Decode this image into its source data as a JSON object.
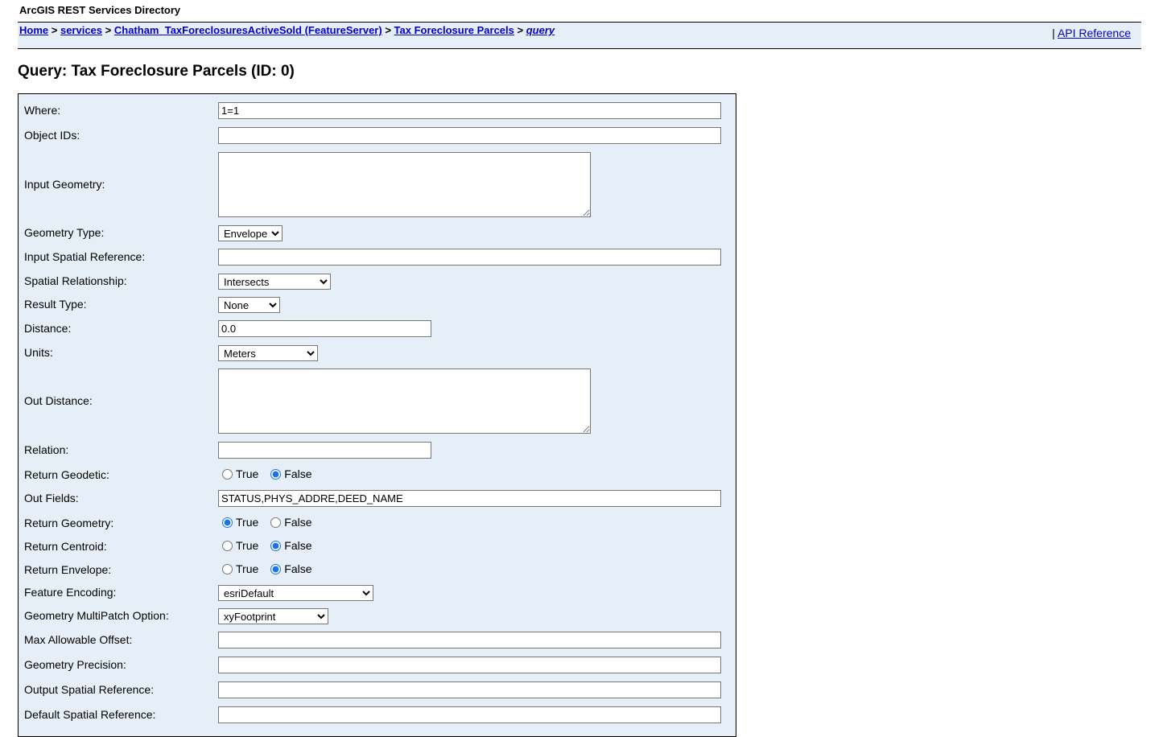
{
  "header": {
    "title": "ArcGIS REST Services Directory"
  },
  "breadcrumb": {
    "home": "Home",
    "services": "services",
    "service": "Chatham_TaxForeclosuresActiveSold (FeatureServer)",
    "layer": "Tax Foreclosure Parcels",
    "current": "query",
    "separator": ">"
  },
  "api_reference": {
    "prefix": "|",
    "label": "API Reference"
  },
  "page_title": "Query: Tax Foreclosure Parcels (ID: 0)",
  "form": {
    "where": {
      "label": "Where:",
      "value": "1=1"
    },
    "object_ids": {
      "label": "Object IDs:",
      "value": ""
    },
    "input_geometry": {
      "label": "Input Geometry:",
      "value": ""
    },
    "geometry_type": {
      "label": "Geometry Type:",
      "value": "Envelope"
    },
    "input_sr": {
      "label": "Input Spatial Reference:",
      "value": ""
    },
    "spatial_rel": {
      "label": "Spatial Relationship:",
      "value": "Intersects"
    },
    "result_type": {
      "label": "Result Type:",
      "value": "None"
    },
    "distance": {
      "label": "Distance:",
      "value": "0.0"
    },
    "units": {
      "label": "Units:",
      "value": "Meters"
    },
    "out_distance": {
      "label": "Out Distance:",
      "value": ""
    },
    "relation": {
      "label": "Relation:",
      "value": ""
    },
    "return_geodetic": {
      "label": "Return Geodetic:",
      "true_label": "True",
      "false_label": "False",
      "selected": "False"
    },
    "out_fields": {
      "label": "Out Fields:",
      "value": "STATUS,PHYS_ADDRE,DEED_NAME"
    },
    "return_geometry": {
      "label": "Return Geometry:",
      "true_label": "True",
      "false_label": "False",
      "selected": "True"
    },
    "return_centroid": {
      "label": "Return Centroid:",
      "true_label": "True",
      "false_label": "False",
      "selected": "False"
    },
    "return_envelope": {
      "label": "Return Envelope:",
      "true_label": "True",
      "false_label": "False",
      "selected": "False"
    },
    "feature_encoding": {
      "label": "Feature Encoding:",
      "value": "esriDefault"
    },
    "multipatch_option": {
      "label": "Geometry MultiPatch Option:",
      "value": "xyFootprint"
    },
    "max_allowable_offset": {
      "label": "Max Allowable Offset:",
      "value": ""
    },
    "geometry_precision": {
      "label": "Geometry Precision:",
      "value": ""
    },
    "output_sr": {
      "label": "Output Spatial Reference:",
      "value": ""
    },
    "default_sr": {
      "label": "Default Spatial Reference:",
      "value": ""
    }
  },
  "colors": {
    "panel_bg": "#e6eef7",
    "link": "#0000cc",
    "radio_checked": "#1a73e8"
  }
}
